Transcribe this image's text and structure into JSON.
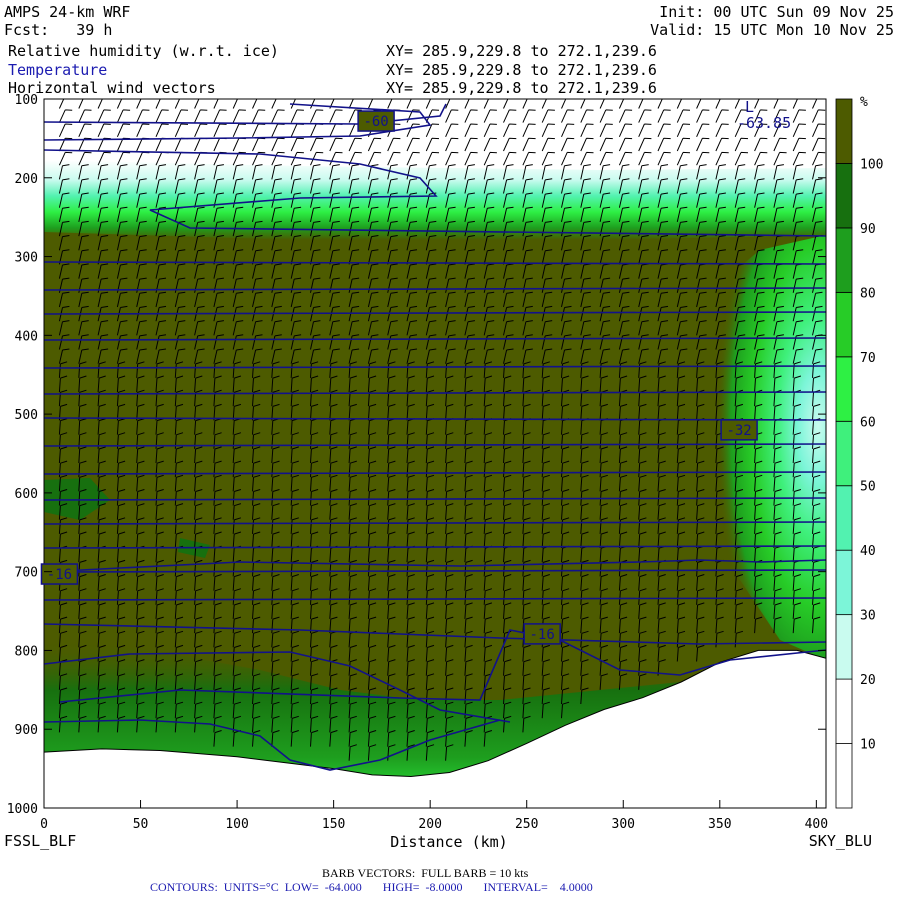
{
  "header": {
    "model": "AMPS 24-km WRF",
    "forecast": "Fcst:   39 h",
    "init": "Init: 00 UTC Sun 09 Nov 25",
    "valid": "Valid: 15 UTC Mon 10 Nov 25",
    "fields": [
      {
        "name": "Relative humidity (w.r.t. ice)",
        "xy": "XY= 285.9,229.8 to 272.1,239.6"
      },
      {
        "name": "Temperature",
        "xy": "XY= 285.9,229.8 to 272.1,239.6"
      },
      {
        "name": "Horizontal wind vectors",
        "xy": "XY= 285.9,229.8 to 272.1,239.6"
      }
    ]
  },
  "footer": {
    "left_station": "FSSL_BLF",
    "right_station": "SKY_BLU",
    "barb": "BARB VECTORS:  FULL BARB = 10 kts",
    "contours": "CONTOURS:  UNITS=°C  LOW=  -64.000       HIGH=  -8.0000       INTERVAL=    4.0000"
  },
  "colors": {
    "olive": "#4d5b00",
    "dark_green": "#17700f",
    "green_90": "#1e9e1e",
    "green_80": "#27cc27",
    "green_70": "#2ef044",
    "green_60": "#3ff07c",
    "teal_50": "#52f2b0",
    "teal_40": "#7cf5d8",
    "pale_30": "#c9fbef",
    "contour": "#12128a"
  },
  "chart_data": {
    "type": "heatmap",
    "title": "Relative humidity (w.r.t. ice)",
    "xlabel": "Distance (km)",
    "ylabel": "",
    "xlim": [
      0,
      405
    ],
    "ylim": [
      1000,
      100
    ],
    "x_ticks": [
      0,
      50,
      100,
      150,
      200,
      250,
      300,
      350,
      400
    ],
    "y_ticks": [
      100,
      200,
      300,
      400,
      500,
      600,
      700,
      800,
      900,
      1000
    ],
    "colorbar": {
      "unit": "%",
      "levels": [
        0,
        10,
        20,
        30,
        40,
        50,
        60,
        70,
        80,
        90,
        100,
        110
      ],
      "labels": [
        10,
        20,
        30,
        40,
        50,
        60,
        70,
        80,
        90,
        100
      ]
    },
    "contour_labels": [
      {
        "text": "-60",
        "x": 172,
        "p": 128
      },
      {
        "text": "-32",
        "x": 360,
        "p": 520
      },
      {
        "text": "-16",
        "x": 8,
        "p": 703
      },
      {
        "text": "-16",
        "x": 258,
        "p": 779
      }
    ],
    "low_marker": {
      "text": "L",
      "value": "-63.85",
      "x": 362,
      "p": 118
    },
    "terrain": [
      [
        0,
        929
      ],
      [
        30,
        925
      ],
      [
        60,
        927
      ],
      [
        100,
        935
      ],
      [
        150,
        950
      ],
      [
        170,
        958
      ],
      [
        190,
        960
      ],
      [
        210,
        955
      ],
      [
        230,
        940
      ],
      [
        250,
        918
      ],
      [
        270,
        895
      ],
      [
        290,
        875
      ],
      [
        310,
        860
      ],
      [
        330,
        840
      ],
      [
        350,
        815
      ],
      [
        370,
        800
      ],
      [
        390,
        800
      ],
      [
        405,
        810
      ]
    ]
  }
}
